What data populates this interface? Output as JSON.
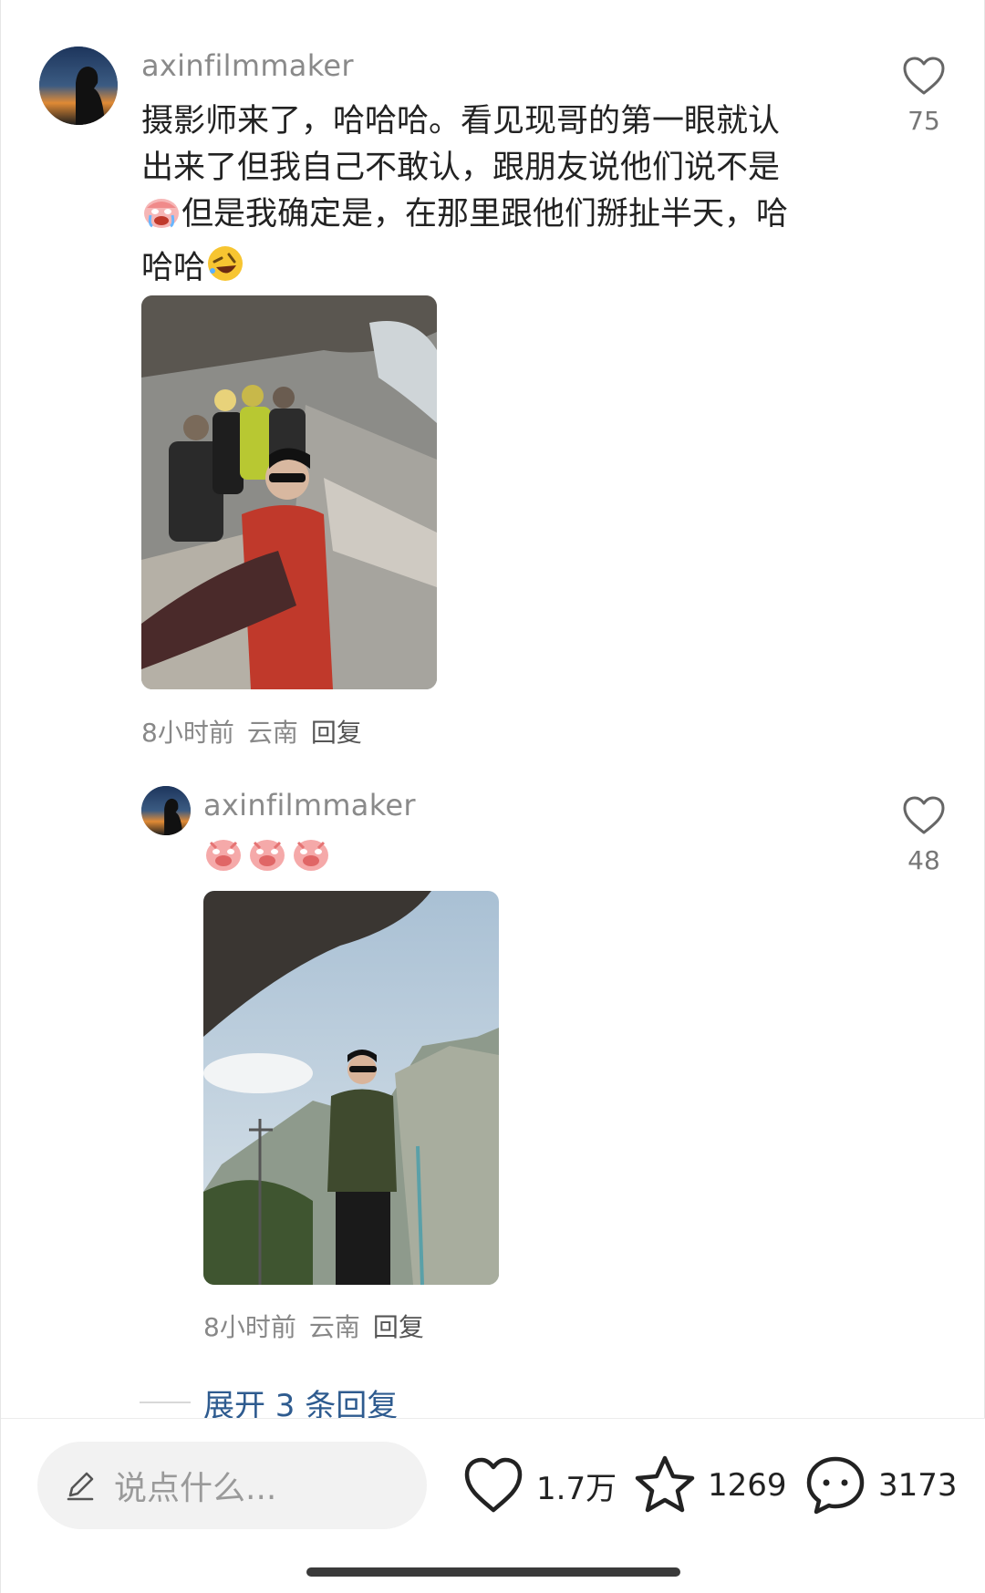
{
  "comment": {
    "username": "axinfilmmaker",
    "text_line1": "摄影师来了，哈哈哈。看见现哥的第一眼就认",
    "text_line2": "出来了但我自己不敢认，跟朋友说他们说不是",
    "text_line3_after_emoji": "但是我确定是，在那里跟他们掰扯半天，哈",
    "text_line4_before_emoji": "哈哈",
    "like_count": "75",
    "time": "8小时前",
    "location": "云南",
    "reply_label": "回复"
  },
  "reply": {
    "username": "axinfilmmaker",
    "emoji_names": [
      "pig-cry-emoji",
      "pig-cry-emoji",
      "pig-cry-emoji"
    ],
    "like_count": "48",
    "time": "8小时前",
    "location": "云南",
    "reply_label": "回复"
  },
  "expand_replies": "展开 3 条回复",
  "bottom_bar": {
    "input_placeholder": "说点什么...",
    "like_count": "1.7万",
    "favorite_count": "1269",
    "comment_count": "3173"
  },
  "icons": {
    "like": "heart-outline-icon",
    "favorite": "star-outline-icon",
    "comment": "chat-bubble-icon",
    "edit": "pencil-icon"
  },
  "colors": {
    "text": "#222222",
    "secondary": "#8a8a8a",
    "link": "#2e5b8f",
    "input_bg": "#f2f2f2"
  }
}
